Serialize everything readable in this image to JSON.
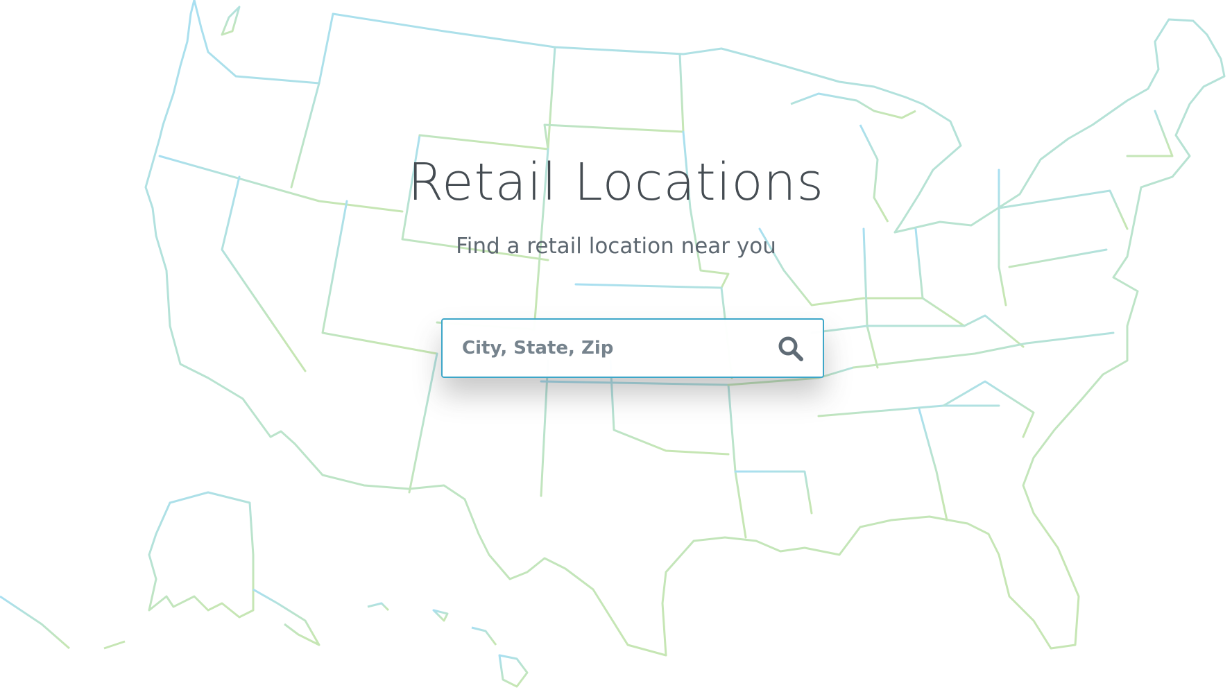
{
  "page": {
    "title": "Retail Locations",
    "subtitle": "Find a retail location near you"
  },
  "search": {
    "placeholder": "City, State, Zip",
    "value": "",
    "icon": "search-icon"
  },
  "background": {
    "icon": "us-map-outline",
    "colors": {
      "map_top": "#a8dff2",
      "map_bottom": "#c6e6b4"
    }
  },
  "colors": {
    "title": "#454c52",
    "subtitle": "#5d6770",
    "search_border": "#3da6c8",
    "search_icon": "#5f6b75"
  }
}
